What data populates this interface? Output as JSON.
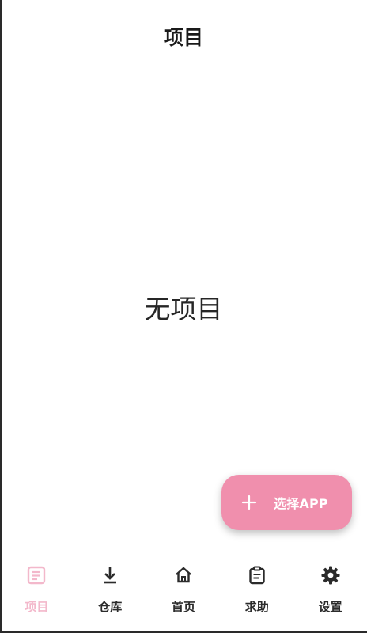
{
  "header": {
    "title": "项目"
  },
  "main": {
    "empty_message": "无项目"
  },
  "fab": {
    "label": "选择APP",
    "icon": "plus-icon"
  },
  "bottom_nav": {
    "items": [
      {
        "label": "项目",
        "icon": "document-list-icon",
        "active": true
      },
      {
        "label": "仓库",
        "icon": "download-icon",
        "active": false
      },
      {
        "label": "首页",
        "icon": "home-icon",
        "active": false
      },
      {
        "label": "求助",
        "icon": "clipboard-icon",
        "active": false
      },
      {
        "label": "设置",
        "icon": "gear-icon",
        "active": false
      }
    ]
  },
  "colors": {
    "accent": "#f08fad",
    "active_nav": "#f3b8cb",
    "text": "#1f1f1f"
  }
}
